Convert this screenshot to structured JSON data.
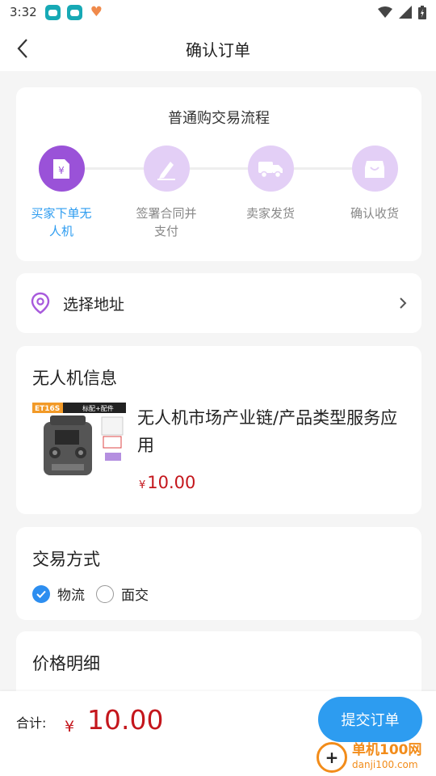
{
  "status_bar": {
    "time": "3:32"
  },
  "header": {
    "title": "确认订单"
  },
  "flow": {
    "title": "普通购交易流程",
    "steps": [
      {
        "line1": "买家下单无",
        "line2": "人机",
        "icon": "yuan-document-icon",
        "active": true
      },
      {
        "line1": "签署合同并",
        "line2": "支付",
        "icon": "pen-sign-icon",
        "active": false
      },
      {
        "line1": "卖家发货",
        "line2": "",
        "icon": "truck-icon",
        "active": false
      },
      {
        "line1": "确认收货",
        "line2": "",
        "icon": "shopping-bag-icon",
        "active": false
      }
    ]
  },
  "address": {
    "label": "选择地址"
  },
  "drone_info": {
    "title": "无人机信息",
    "product_name": "无人机市场产业链/产品类型服务应用",
    "currency": "¥",
    "price": "10.00",
    "image_tag": "ET16S",
    "image_caption": "标配+配件"
  },
  "trade": {
    "title": "交易方式",
    "options": [
      {
        "label": "物流",
        "checked": true
      },
      {
        "label": "面交",
        "checked": false
      }
    ]
  },
  "price_detail": {
    "title": "价格明细"
  },
  "bottom": {
    "total_label": "合计:",
    "currency": "¥",
    "total": "10.00",
    "submit_label": "提交订单"
  },
  "watermark": {
    "title": "单机100网",
    "url": "danji100.com"
  },
  "colors": {
    "accent_blue": "#2d9cf0",
    "purple": "#9a52d8",
    "light_purple": "#e3cff6",
    "price_red": "#c4161c"
  }
}
